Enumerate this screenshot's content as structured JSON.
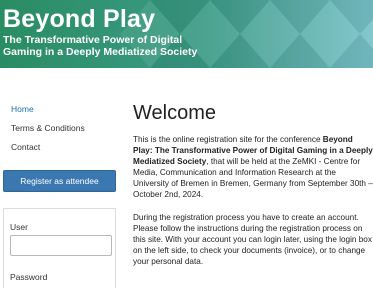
{
  "banner": {
    "title": "Beyond Play",
    "subtitle_line1": "The Transformative Power of Digital",
    "subtitle_line2": "Gaming in a Deeply Mediatized Society"
  },
  "sidebar": {
    "nav": [
      {
        "label": "Home"
      },
      {
        "label": "Terms & Conditions"
      },
      {
        "label": "Contact"
      }
    ],
    "register_label": "Register as attendee",
    "login": {
      "user_label": "User",
      "user_value": "",
      "password_label": "Password"
    }
  },
  "main": {
    "title": "Welcome",
    "p1": {
      "before": "This is the online registration site for the conference ",
      "bold": "Beyond Play: The Transformative Power of Digital Gaming in a Deeply Mediatized Society",
      "after": ", that will be held at the ZeMKI - Centre for Media, Communication and Information Research at the University of Bremen in Bremen, Germany from September 30th – October 2nd, 2024."
    },
    "p2": "During the registration process you have to create an account. Please follow the instructions during the registration process on this site. With your account you can login later, using the login box on the left side, to check your documents (invoice), or to change your personal data."
  },
  "colors": {
    "banner": "#2f8b70",
    "link": "#1f6fb2",
    "button": "#3b77b0"
  }
}
